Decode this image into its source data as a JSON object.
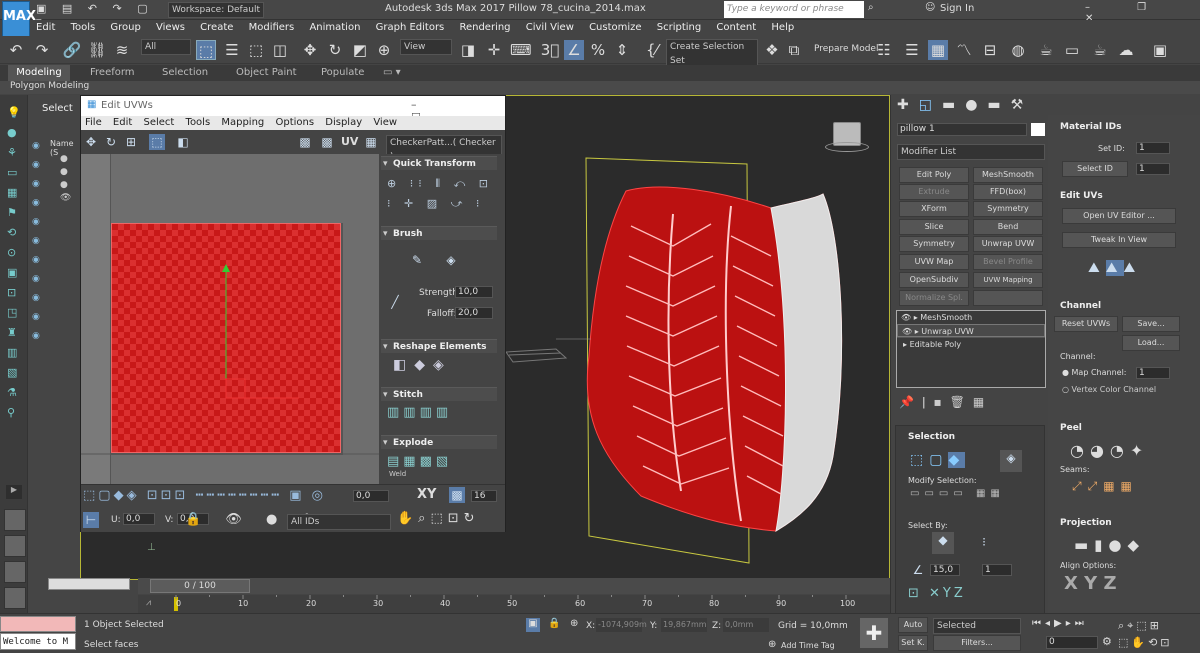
{
  "app": {
    "title": "Autodesk 3ds Max 2017    Pillow 78_cucina_2014.max",
    "logo": "MAX",
    "workspace": "Workspace: Default",
    "search_placeholder": "Type a keyword or phrase",
    "sign_in": "Sign In"
  },
  "menu": [
    "Edit",
    "Tools",
    "Group",
    "Views",
    "Create",
    "Modifiers",
    "Animation",
    "Graph Editors",
    "Rendering",
    "Civil View",
    "Customize",
    "Scripting",
    "Content",
    "Help"
  ],
  "toolbar": {
    "filter": "All",
    "ref_coord": "View",
    "selection_set": "Create Selection Set",
    "prepare_model": "Prepare Model"
  },
  "ribbon": {
    "tabs": [
      "Modeling",
      "Freeform",
      "Selection",
      "Object Paint",
      "Populate"
    ],
    "sub": "Polygon Modeling"
  },
  "scene": {
    "select_tab": "Select",
    "name_col": "Name (S"
  },
  "uvw": {
    "title": "Edit UVWs",
    "menu": [
      "File",
      "Edit",
      "Select",
      "Tools",
      "Mapping",
      "Options",
      "Display",
      "View"
    ],
    "uv_label": "UV",
    "texture_dropdown": "CheckerPatt...( Checker )",
    "rollouts": {
      "quick_transform": "Quick Transform",
      "brush": "Brush",
      "strength_label": "Strength:",
      "strength_value": "10,0",
      "falloff_label": "Falloff:",
      "falloff_value": "20,0",
      "reshape": "Reshape Elements",
      "stitch": "Stitch",
      "explode": "Explode",
      "weld": "Weld"
    },
    "bottom": {
      "u_label": "U:",
      "u_value": "0,0",
      "v_label": "V:",
      "v_value": "0,0",
      "rot_value": "0,0",
      "xy": "XY",
      "grid_num": "16",
      "ids": "All IDs"
    }
  },
  "command_panel": {
    "object_name": "pillow 1",
    "modifier_list": "Modifier List",
    "buttons": [
      "Edit Poly",
      "MeshSmooth",
      "Extrude",
      "FFD(box)",
      "XForm",
      "Symmetry",
      "Slice",
      "Bend",
      "Symmetry",
      "Unwrap UVW",
      "UVW Map",
      "Bevel Profile",
      "OpenSubdiv",
      "UVW Mapping Clear",
      "Normalize Spl."
    ],
    "stack": [
      "MeshSmooth",
      "Unwrap UVW",
      "Editable Poly"
    ],
    "selection_title": "Selection",
    "modify_selection": "Modify Selection:",
    "select_by": "Select By:",
    "angle_value": "15,0",
    "num_value": "1"
  },
  "right_panel": {
    "material_ids": "Material IDs",
    "set_id_label": "Set ID:",
    "set_id_value": "1",
    "select_id_btn": "Select ID",
    "select_id_value": "1",
    "edit_uvs": "Edit UVs",
    "open_uv_editor": "Open UV Editor ...",
    "tweak_in_view": "Tweak In View",
    "channel": "Channel",
    "reset_uvws": "Reset UVWs",
    "save": "Save...",
    "load": "Load...",
    "channel_label": "Channel:",
    "map_channel_label": "Map Channel:",
    "map_channel_value": "1",
    "vertex_color_channel": "Vertex Color Channel",
    "peel": "Peel",
    "seams": "Seams:",
    "projection": "Projection",
    "align_options": "Align Options:",
    "axes": "X Y Z"
  },
  "timeline": {
    "frame": "0 / 100",
    "ticks": [
      "0",
      "10",
      "20",
      "30",
      "40",
      "50",
      "60",
      "70",
      "80",
      "90",
      "100"
    ]
  },
  "status": {
    "listener": "Welcome to M",
    "object_selected": "1 Object Selected",
    "prompt": "Select faces",
    "x_label": "X:",
    "x_value": "-1074,909m",
    "y_label": "Y:",
    "y_value": "19,867mm",
    "z_label": "Z:",
    "z_value": "0,0mm",
    "grid": "Grid = 10,0mm",
    "add_time_tag": "Add Time Tag",
    "auto": "Auto",
    "selected": "Selected",
    "set_key": "Set K.",
    "filters": "Filters...",
    "frame_value": "0"
  },
  "colors": {
    "uv_red": "#c81818",
    "viewport_border": "#b7b735",
    "accent": "#3a8fd6"
  }
}
